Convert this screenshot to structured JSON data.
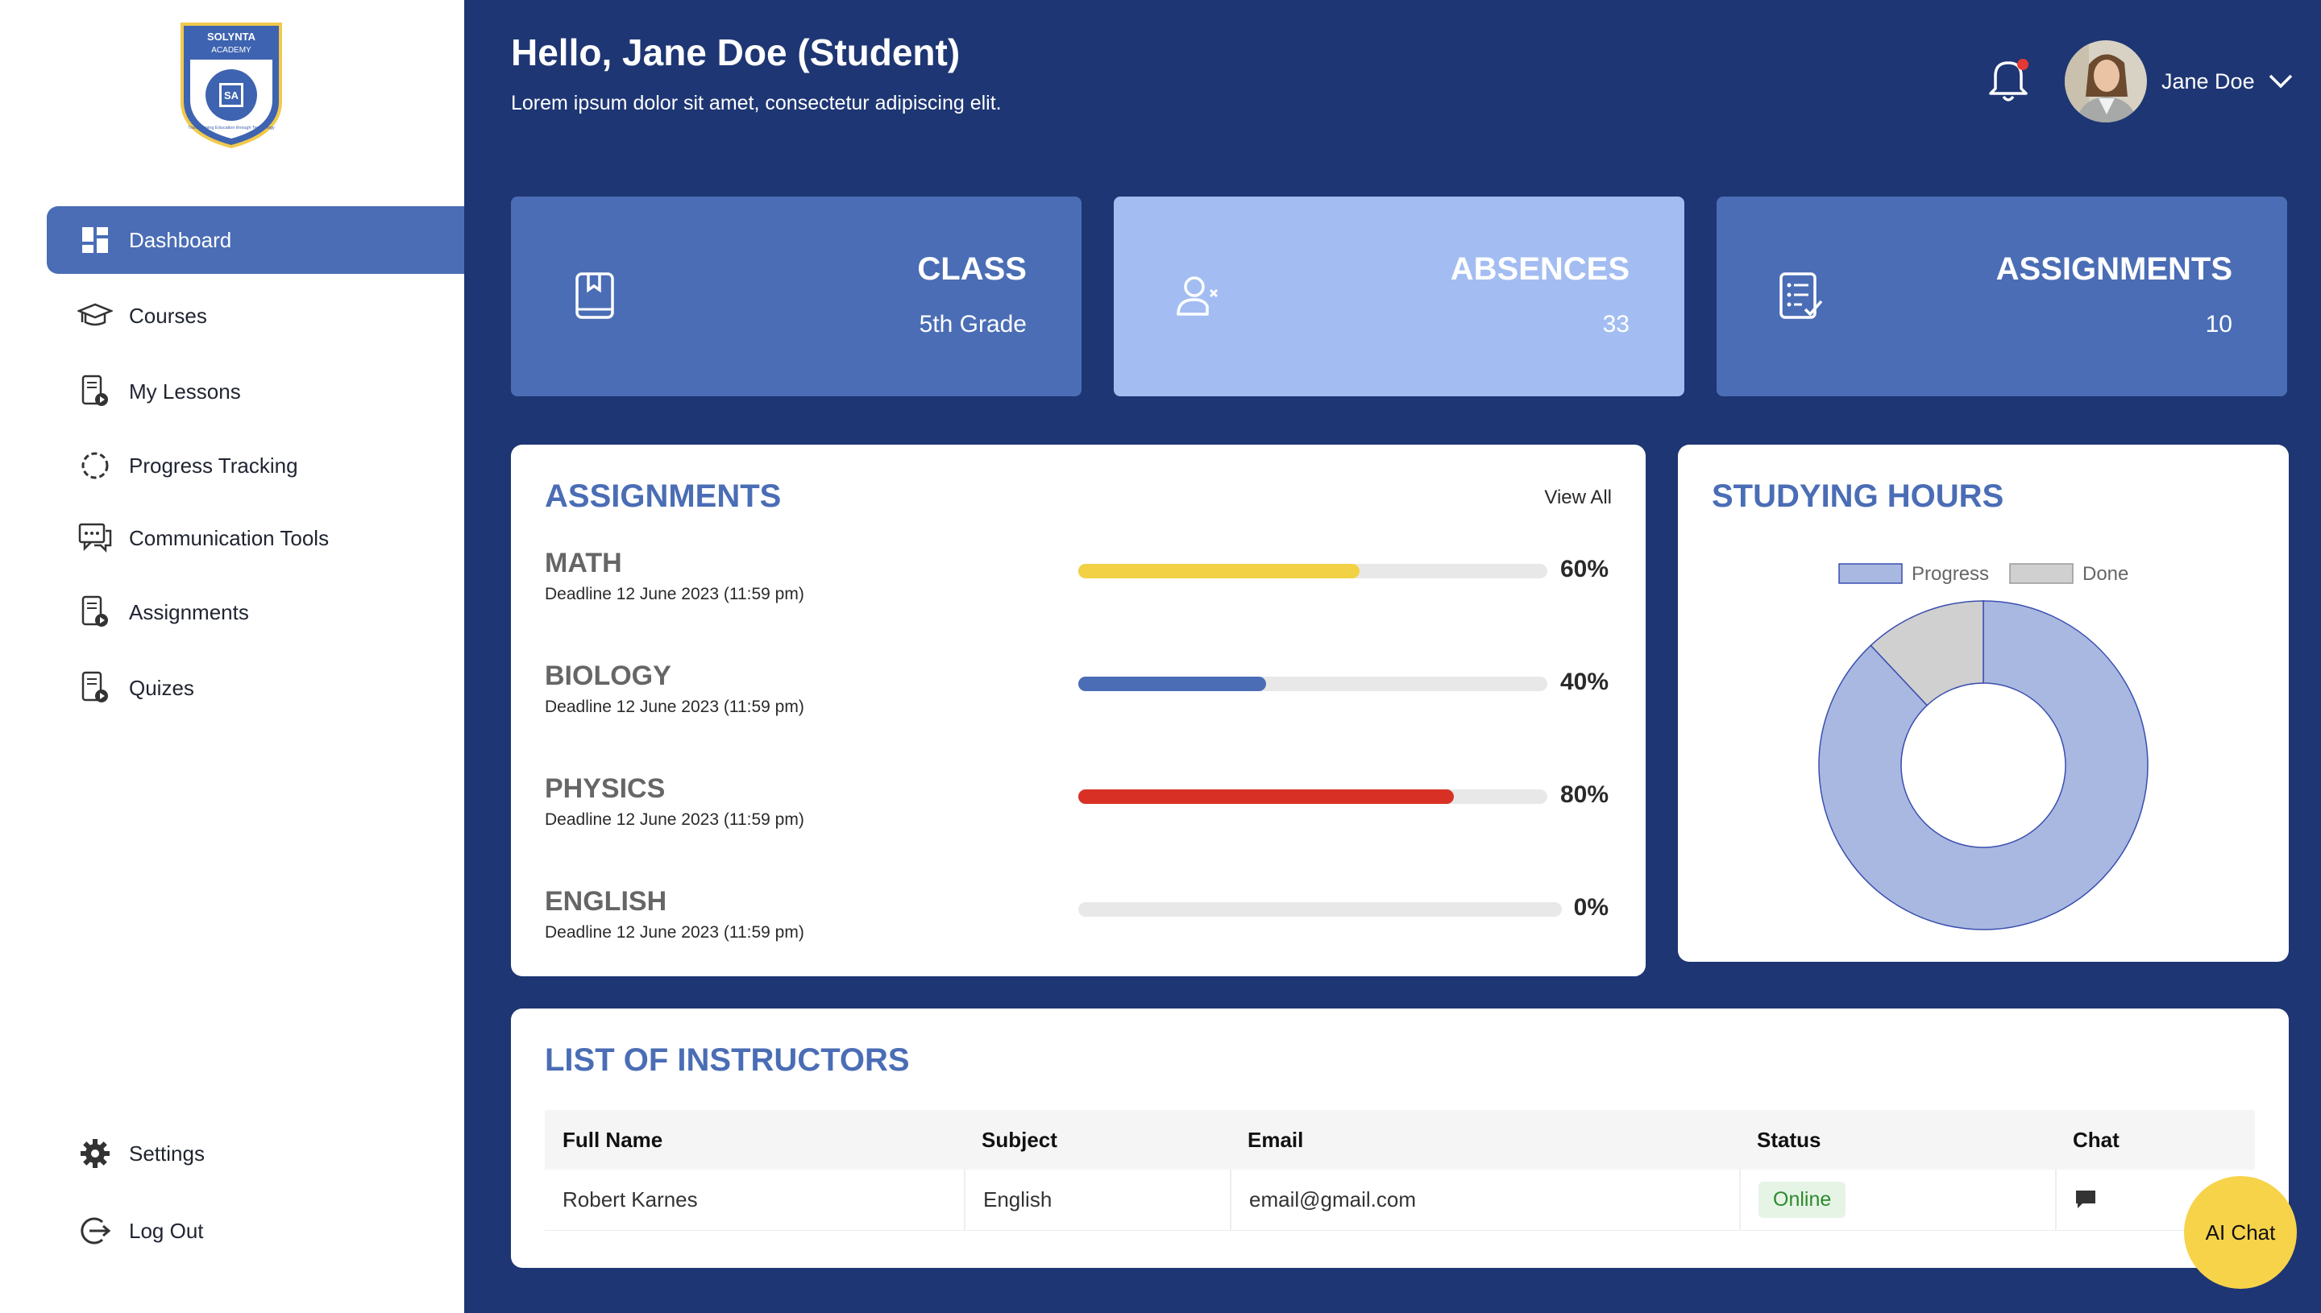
{
  "logo": {
    "line1": "SOLYNTA",
    "line2": "ACADEMY",
    "initials": "SA",
    "motto": "Transforming Education through Technology"
  },
  "sidebar": {
    "items": [
      {
        "label": "Dashboard",
        "icon": "dashboard-icon",
        "active": true
      },
      {
        "label": "Courses",
        "icon": "graduation-cap-icon"
      },
      {
        "label": "My Lessons",
        "icon": "lesson-video-icon"
      },
      {
        "label": "Progress Tracking",
        "icon": "progress-circle-icon"
      },
      {
        "label": "Communication Tools",
        "icon": "chat-bubbles-icon"
      },
      {
        "label": "Assignments",
        "icon": "assignment-video-icon"
      },
      {
        "label": "Quizes",
        "icon": "quiz-video-icon"
      }
    ],
    "bottom": [
      {
        "label": "Settings",
        "icon": "gear-icon"
      },
      {
        "label": "Log Out",
        "icon": "logout-icon"
      }
    ]
  },
  "header": {
    "greeting": "Hello, Jane Doe (Student)",
    "subtitle": "Lorem ipsum dolor sit amet, consectetur adipiscing elit.",
    "user_name": "Jane Doe",
    "notification_dot": true
  },
  "stats": [
    {
      "title": "CLASS",
      "value": "5th Grade",
      "icon": "book-icon",
      "color": "#4a6db5"
    },
    {
      "title": "ABSENCES",
      "value": "33",
      "icon": "user-x-icon",
      "color": "#a3bdf2"
    },
    {
      "title": "ASSIGNMENTS",
      "value": "10",
      "icon": "checklist-icon",
      "color": "#4a6db5"
    }
  ],
  "assignments": {
    "title": "ASSIGNMENTS",
    "view_all": "View All",
    "items": [
      {
        "subject": "MATH",
        "deadline": "Deadline 12 June 2023 (11:59 pm)",
        "progress": 0.6,
        "pct": "60%",
        "color": "#f2d145"
      },
      {
        "subject": "BIOLOGY",
        "deadline": "Deadline 12 June 2023 (11:59 pm)",
        "progress": 0.4,
        "pct": "40%",
        "color": "#4a6db5"
      },
      {
        "subject": "PHYSICS",
        "deadline": "Deadline 12 June 2023 (11:59 pm)",
        "progress": 0.8,
        "pct": "80%",
        "color": "#d93025"
      },
      {
        "subject": "ENGLISH",
        "deadline": "Deadline 12 June 2023 (11:59 pm)",
        "progress": 0.0,
        "pct": "0%",
        "color": "#4a6db5"
      }
    ]
  },
  "studying_hours": {
    "title": "STUDYING HOURS"
  },
  "chart_data": {
    "type": "pie",
    "title": "STUDYING HOURS",
    "donut": true,
    "legend_position": "top",
    "categories": [
      "Progress",
      "Done"
    ],
    "values": [
      88,
      12
    ],
    "colors": [
      "#a9b8e0",
      "#d0d0d0"
    ]
  },
  "instructors": {
    "title": "LIST OF INSTRUCTORS",
    "columns": [
      "Full Name",
      "Subject",
      "Email",
      "Status",
      "Chat"
    ],
    "rows": [
      {
        "name": "Robert Karnes",
        "subject": "English",
        "email": "email@gmail.com",
        "status": "Online"
      }
    ]
  },
  "ai_chat": {
    "label": "AI Chat"
  }
}
